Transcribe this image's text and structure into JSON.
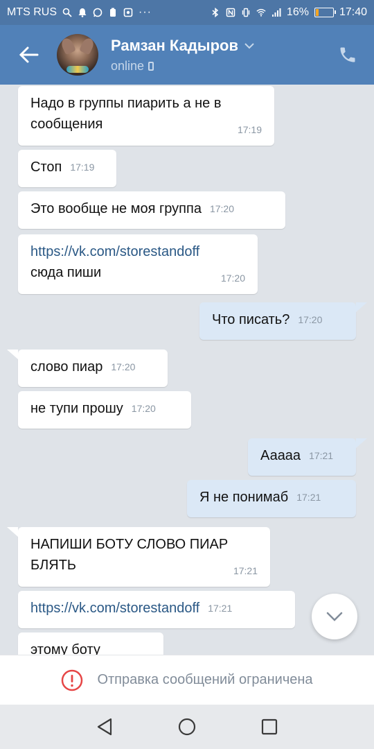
{
  "status_bar": {
    "carrier": "MTS RUS",
    "battery_percent": "16%",
    "battery_level": 0.16,
    "time": "17:40",
    "overflow": "···"
  },
  "header": {
    "name": "Рамзан Кадыров",
    "status": "online"
  },
  "messages": [
    {
      "dir": "in",
      "lines": [
        "Надо в группы пиарить а не в",
        "сообщения"
      ],
      "time": "17:19"
    },
    {
      "dir": "in",
      "text": "Стоп",
      "time": "17:19"
    },
    {
      "dir": "in",
      "text": "Это вообще не моя группа",
      "time": "17:20"
    },
    {
      "dir": "in",
      "link": "https://vk.com/storestandoff",
      "text": "сюда пиши",
      "time": "17:20"
    },
    {
      "dir": "out",
      "text": "Что писать?",
      "time": "17:20"
    },
    {
      "dir": "in",
      "text": "слово пиар",
      "time": "17:20"
    },
    {
      "dir": "in",
      "text": "не тупи прошу",
      "time": "17:20"
    },
    {
      "dir": "out",
      "text": "Ааааа",
      "time": "17:21"
    },
    {
      "dir": "out",
      "text": "Я не понимаб",
      "time": "17:21"
    },
    {
      "dir": "in",
      "lines": [
        "НАПИШИ БОТУ СЛОВО ПИАР",
        "БЛЯТЬ"
      ],
      "time": "17:21"
    },
    {
      "dir": "in",
      "link": "https://vk.com/storestandoff",
      "time": "17:21"
    },
    {
      "dir": "in",
      "text": "этому боту",
      "time": ""
    }
  ],
  "restriction": {
    "text": "Отправка сообщений ограничена"
  },
  "colors": {
    "header": "#5181b8",
    "status_bar": "#4d76a6",
    "outgoing_bubble": "#dbe8f6",
    "link": "#2a5885",
    "warning": "#e64646"
  },
  "icons": [
    "back-arrow-icon",
    "phone-icon",
    "chevron-down-icon",
    "warning-icon",
    "nav-back-icon",
    "nav-home-icon",
    "nav-recents-icon"
  ]
}
